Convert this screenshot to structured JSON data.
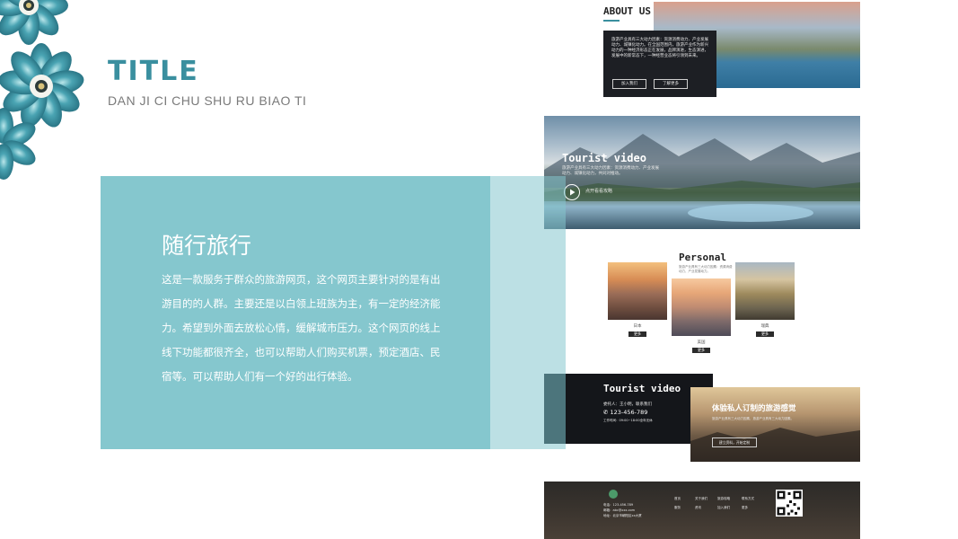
{
  "slide": {
    "title": "TITLE",
    "subtitle": "DAN JI CI CHU SHU RU BIAO TI",
    "panel_heading": "随行旅行",
    "panel_text": "这是一款服务于群众的旅游网页，这个网页主要针对的是有出游目的的人群。主要还是以白领上班族为主，有一定的经济能力。希望到外面去放松心情，缓解城市压力。这个网页的线上线下功能都很齐全，也可以帮助人们购买机票，预定酒店、民宿等。可以帮助人们有一个好的出行体验。"
  },
  "mock_about": {
    "title": "ABOUT US",
    "body": "旅游产业具有三大动力因素：资源消费动力、产业发展动力、城镇化动力。在全国范围内，旅游产业作为新兴动力的一种经济形态正在发展，品牌演进，生态演进，发展中的新常态下，一种经营业态将引领到未来。",
    "button1": "加入我们",
    "button2": "了解更多"
  },
  "mock_video": {
    "title": "Tourist video",
    "body": "旅游产业具有三大动力因素：资源消费动力、产业发展动力、城镇化动力，共同对推动。",
    "play_label": "点开看看攻略"
  },
  "mock_personal": {
    "title": "Personal",
    "desc": "旅游产业具有三大动力因素：资源消费动力、产业发展动力。",
    "cards": [
      {
        "caption": "日本",
        "button": "更多"
      },
      {
        "caption": "美国",
        "button": "更多"
      },
      {
        "caption": "瑞典",
        "button": "更多"
      }
    ]
  },
  "mock_contact": {
    "title": "Tourist video",
    "line1": "委托人：王小明，联系我们",
    "phone": "123-456-789",
    "line2": "工作时间：09:00~18:00全年无休"
  },
  "mock_custom": {
    "title": "体验私人订制的旅游感觉",
    "body": "旅游产业具有三大动力因素，旅游产业具有三大动力因素。",
    "button": "建立资料，开始定制"
  },
  "mock_footer": {
    "info1": "电话：123-456-789",
    "info2": "邮箱：abc@xxx.com",
    "info3": "地址：北京市朝阳区xx大厦",
    "links": [
      "首页",
      "关于我们",
      "旅游攻略",
      "联系方式",
      "服务",
      "资讯",
      "加入我们",
      "更多"
    ]
  }
}
